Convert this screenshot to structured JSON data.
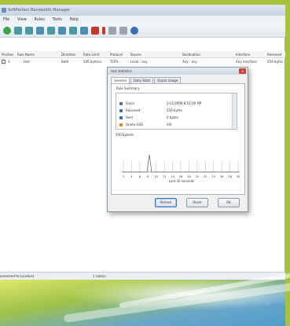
{
  "window": {
    "title": "SoftPerfect Bandwidth Manager"
  },
  "menu": [
    "File",
    "View",
    "Rules",
    "Tools",
    "Help"
  ],
  "toolbar_icons": [
    "start-icon",
    "rule-icon",
    "rule-icon",
    "rule-icon",
    "filter-icon",
    "filter-icon",
    "filter-icon",
    "filter-icon",
    "delete-icon",
    "usage-icon",
    "chart-icon",
    "export-icon",
    "help-icon"
  ],
  "table": {
    "columns": [
      "Position",
      "Rule Name",
      "Direction",
      "Rate Limit",
      "Protocol",
      "Source",
      "Destination",
      "Interface",
      "Received"
    ],
    "rows": [
      [
        "1",
        "test",
        "Both",
        "500 bytes/s",
        "TCP/I...",
        "Local : any",
        "Any : any",
        "Any interface",
        "559 bytes"
      ]
    ]
  },
  "dialog": {
    "title": "test statistics",
    "close": "x",
    "tabs": [
      "General",
      "Daily Stats",
      "Quota Usage"
    ],
    "summary_label": "Rule Summary",
    "summary": [
      {
        "label": "Since",
        "value": "2/11/2008 8:51:00 PM",
        "icon": "clock-icon",
        "color": "#5d6b7c"
      },
      {
        "label": "Received",
        "value": "559 bytes",
        "icon": "received-icon",
        "color": "#3b6fb5"
      },
      {
        "label": "Sent",
        "value": "0 bytes",
        "icon": "sent-icon",
        "color": "#3b6fb5"
      },
      {
        "label": "Quota USD",
        "value": "0/0",
        "icon": "quota-icon",
        "color": "#e08a1e"
      }
    ],
    "graph_label": "500 bytes/s",
    "graph_ticks": [
      "2",
      "4",
      "6",
      "8",
      "10",
      "12",
      "14",
      "16",
      "18",
      "20",
      "22",
      "24",
      "26",
      "28",
      "30"
    ],
    "graph_caption": "Last 30 seconds",
    "buttons": {
      "refresh": "Refresh",
      "reset": "Reset",
      "ok": "OK"
    }
  },
  "status": {
    "connection": "onnected to localhost",
    "rules": "1 rule(s)"
  }
}
